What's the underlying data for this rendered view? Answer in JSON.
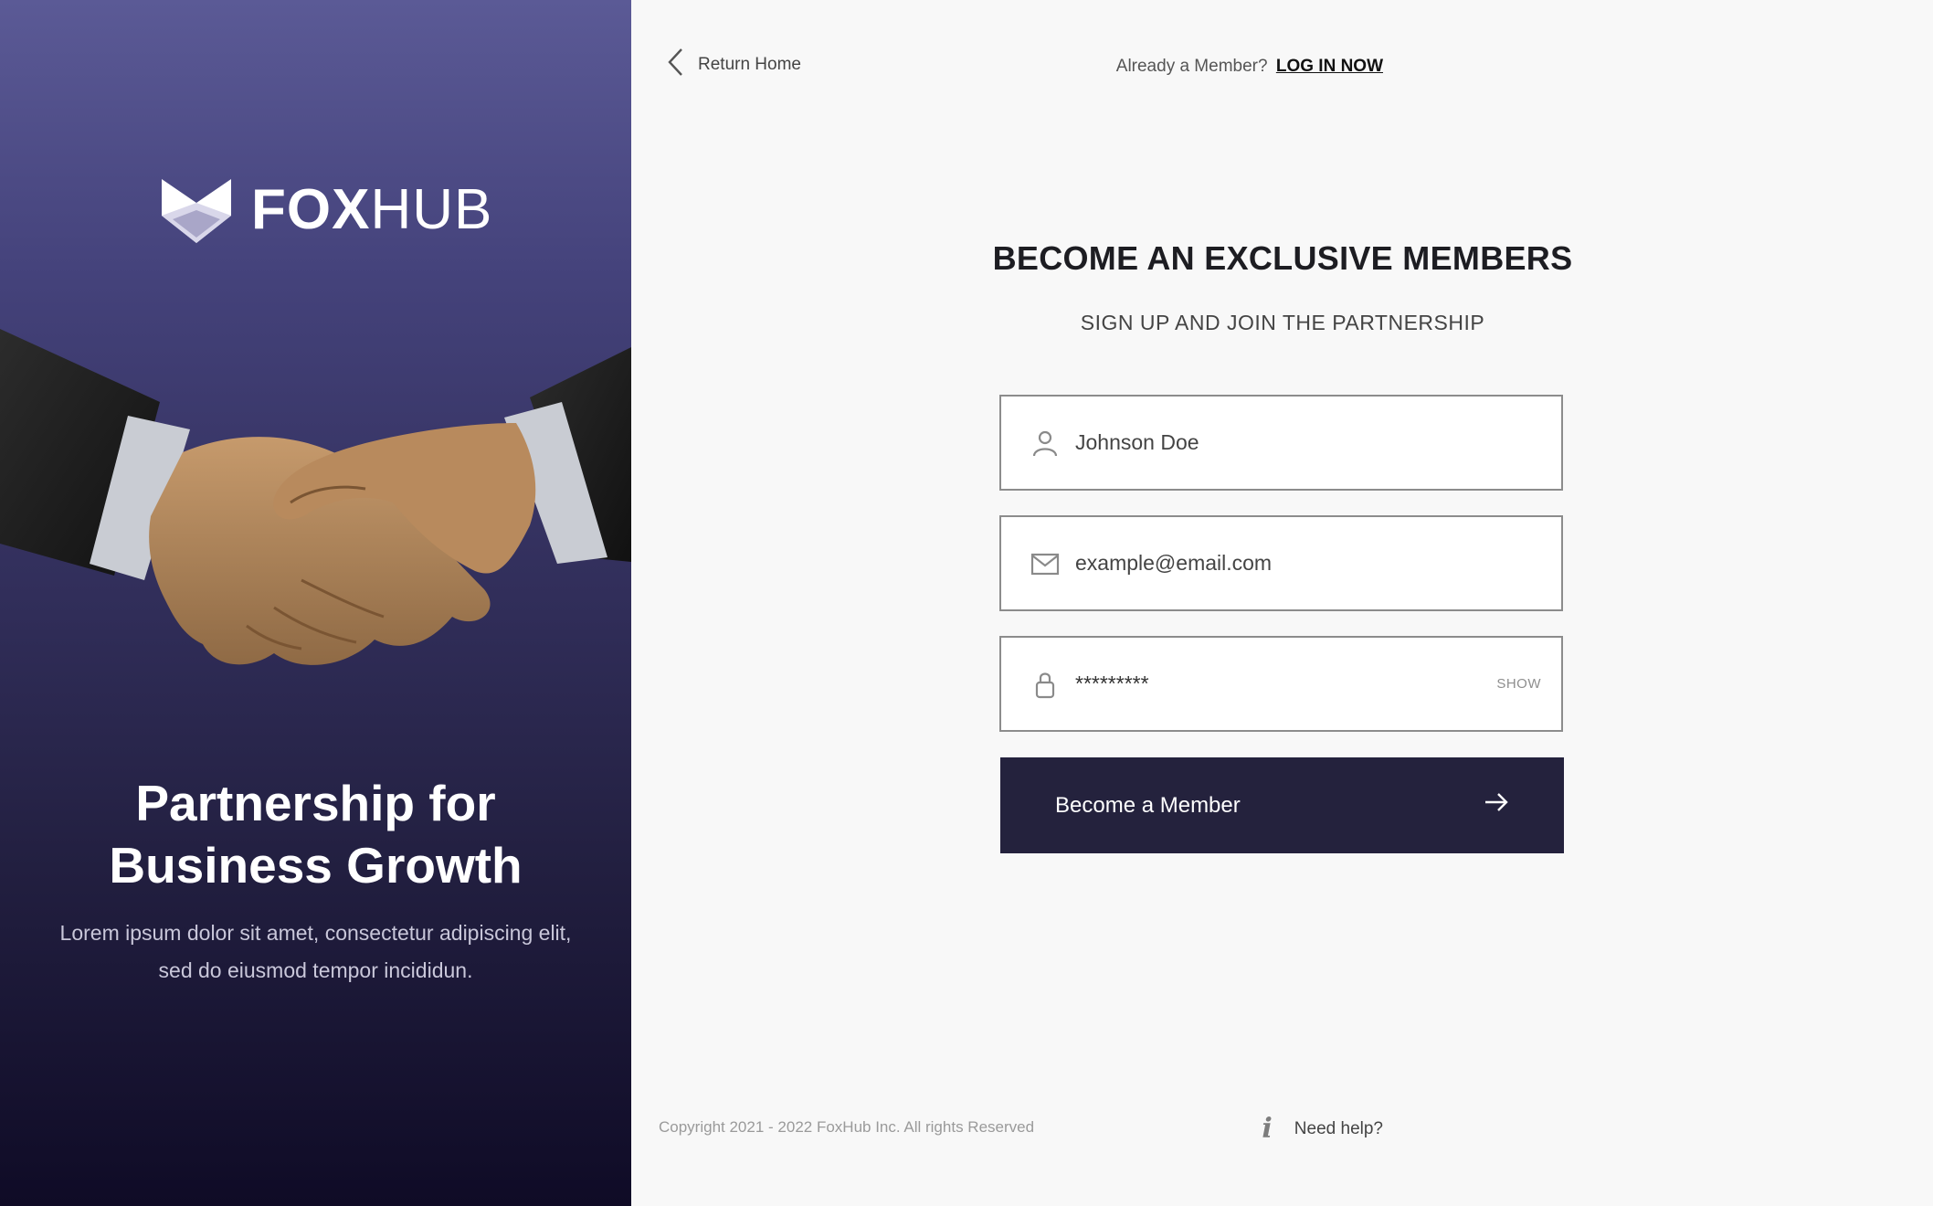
{
  "brand": {
    "name_bold": "FOX",
    "name_light": "HUB"
  },
  "hero": {
    "headline_line1": "Partnership for",
    "headline_line2": "Business Growth",
    "tagline": "Lorem ipsum dolor sit amet, consectetur adipiscing elit, sed do eiusmod tempor incididun."
  },
  "nav": {
    "return_label": "Return Home",
    "member_prompt": "Already a Member?",
    "login_label": "LOG IN NOW"
  },
  "form": {
    "title": "BECOME AN EXCLUSIVE MEMBERS",
    "subtitle": "SIGN UP AND JOIN THE PARTNERSHIP",
    "name_placeholder": "Johnson Doe",
    "email_placeholder": "example@email.com",
    "password_value": "*********",
    "show_label": "SHOW",
    "submit_label": "Become a Member"
  },
  "footer": {
    "copyright": "Copyright 2021 - 2022 FoxHub Inc. All rights Reserved",
    "help_label": "Need help?"
  },
  "icons": {
    "logo": "fox-logo-icon",
    "back": "chevron-left-icon",
    "user": "user-icon",
    "email": "mail-icon",
    "password": "lock-icon",
    "submit": "arrow-right-icon",
    "help": "info-icon"
  },
  "colors": {
    "panel_top": "#5b5a96",
    "panel_bottom": "#0f0b26",
    "button": "#24223d",
    "page_bg": "#f8f8f8"
  }
}
